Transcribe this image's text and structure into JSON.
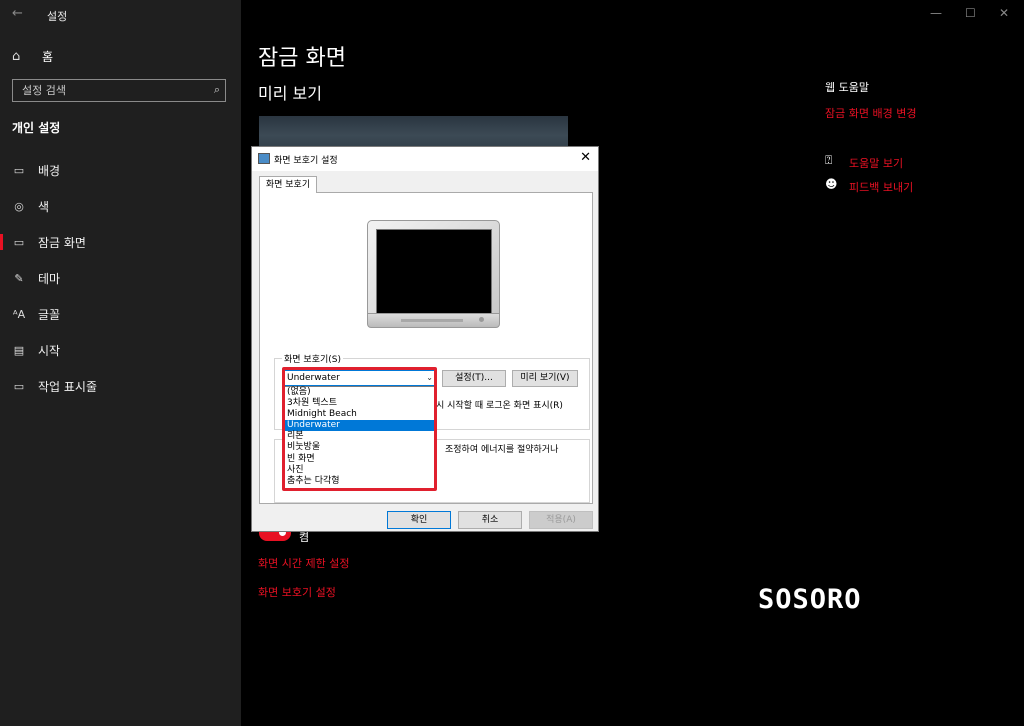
{
  "app": {
    "title": "설정",
    "back_icon": "arrow-left-icon"
  },
  "sidebar": {
    "home_label": "홈",
    "search_placeholder": "설정 검색",
    "section_header": "개인 설정",
    "items": [
      {
        "label": "배경",
        "icon": "picture-icon"
      },
      {
        "label": "색",
        "icon": "palette-icon"
      },
      {
        "label": "잠금 화면",
        "icon": "lock-screen-icon",
        "active": true
      },
      {
        "label": "테마",
        "icon": "brush-icon"
      },
      {
        "label": "글꼴",
        "icon": "font-icon"
      },
      {
        "label": "시작",
        "icon": "start-icon"
      },
      {
        "label": "작업 표시줄",
        "icon": "taskbar-icon"
      }
    ]
  },
  "main": {
    "title": "잠금 화면",
    "preview_label": "미리 보기",
    "toggle_text": "켬",
    "link_screen_timeout": "화면 시간 제한 설정",
    "link_screensaver": "화면 보호기 설정"
  },
  "help": {
    "title": "웹 도움말",
    "link_change_background": "잠금 화면 배경 변경",
    "get_help": "도움말 보기",
    "send_feedback": "피드백 보내기"
  },
  "window_controls": {
    "minimize": "—",
    "maximize": "☐",
    "close": "✕"
  },
  "watermark": "SOSORO",
  "dialog": {
    "title": "화면 보호기 설정",
    "close": "✕",
    "tab": "화면 보호기",
    "group_label": "화면 보호기(S)",
    "selected_value": "Underwater",
    "settings_button": "설정(T)...",
    "preview_button": "미리 보기(V)",
    "resume_text": "시 시작할 때 로그온 화면 표시(R)",
    "power_text": "조정하여 에너지를 절약하거나",
    "options": [
      "(없음)",
      "3차원 텍스트",
      "Midnight Beach",
      "Underwater",
      "리본",
      "비눗방울",
      "빈 화면",
      "사진",
      "춤추는 다각형"
    ],
    "selected_index": 3,
    "ok": "확인",
    "cancel": "취소",
    "apply": "적용(A)"
  },
  "colors": {
    "accent": "#e81123",
    "selection": "#0078d7",
    "highlight_box": "#e0202e"
  }
}
